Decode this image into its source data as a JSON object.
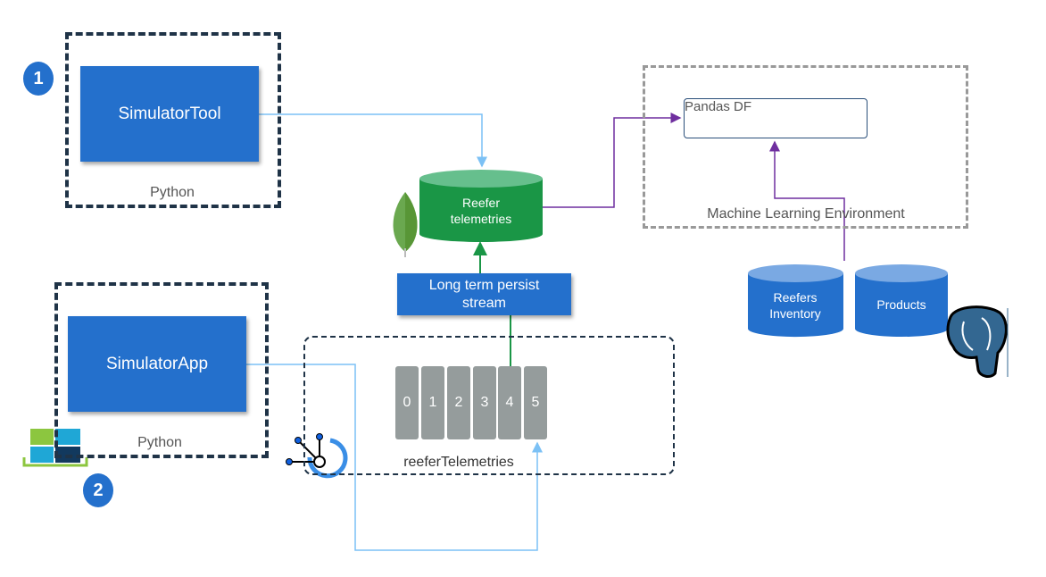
{
  "steps": [
    "1",
    "2"
  ],
  "simulator_tool": {
    "label": "SimulatorTool",
    "runtime": "Python"
  },
  "simulator_app": {
    "label": "SimulatorApp",
    "runtime": "Python"
  },
  "mongo_db": {
    "label_line1": "Reefer",
    "label_line2": "telemetries"
  },
  "persist_stream": {
    "label_line1": "Long term persist",
    "label_line2": "stream"
  },
  "kafka_topic": {
    "name": "reeferTelemetries",
    "partitions": [
      "0",
      "1",
      "2",
      "3",
      "4",
      "5"
    ]
  },
  "ml_env": {
    "label": "Machine Learning Environment",
    "dataframe": "Pandas DF"
  },
  "postgres_tables": [
    {
      "line1": "Reefers",
      "line2": "Inventory"
    },
    {
      "line1": "Products",
      "line2": ""
    }
  ],
  "colors": {
    "blue": "#2470cc",
    "green": "#1a9646",
    "light_blue": "#7cc1f5",
    "purple": "#6f2f9f",
    "partition_gray": "#959c9c"
  },
  "icons": [
    "mongodb-leaf-icon",
    "kafka-icon",
    "containers-icon",
    "postgresql-elephant-icon"
  ]
}
